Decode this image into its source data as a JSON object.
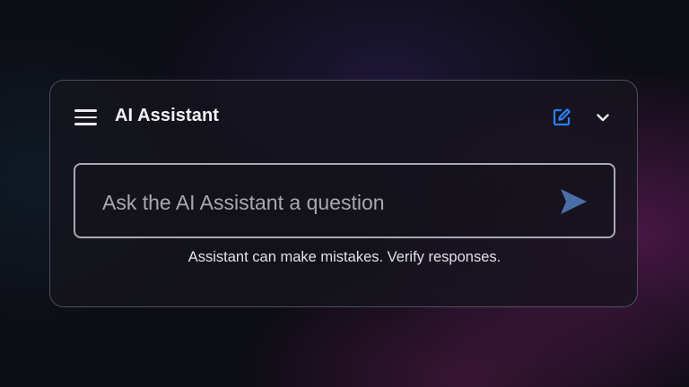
{
  "header": {
    "title": "AI Assistant",
    "icons": {
      "menu": "hamburger-menu-icon",
      "new_chat": "edit-note-icon",
      "collapse": "chevron-down-icon"
    }
  },
  "input": {
    "placeholder": "Ask the AI Assistant a question",
    "value": "",
    "send_icon": "send-icon"
  },
  "footer": {
    "disclaimer": "Assistant can make mistakes. Verify responses."
  },
  "colors": {
    "accent_blue": "#2d7ff9",
    "send_blue": "#4a6ea8",
    "text_primary": "#f3f3f7",
    "panel_border": "#8e8ea6"
  }
}
